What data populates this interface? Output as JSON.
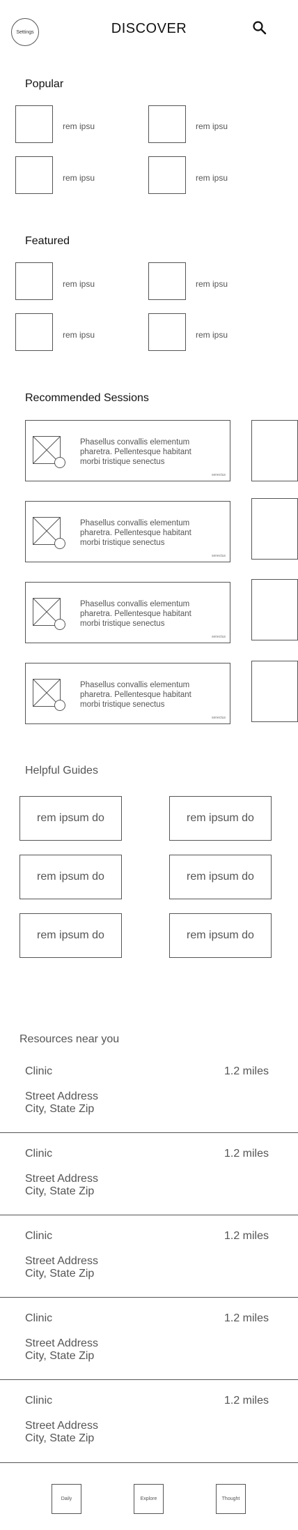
{
  "header": {
    "settings_label": "Settings",
    "title": "DISCOVER",
    "search_icon": "search-icon"
  },
  "popular": {
    "title": "Popular",
    "items": [
      {
        "label": "rem ipsu"
      },
      {
        "label": "rem ipsu"
      },
      {
        "label": "rem ipsu"
      },
      {
        "label": "rem ipsu"
      }
    ]
  },
  "featured": {
    "title": "Featured",
    "items": [
      {
        "label": "rem ipsu"
      },
      {
        "label": "rem ipsu"
      },
      {
        "label": "rem ipsu"
      },
      {
        "label": "rem ipsu"
      }
    ]
  },
  "recommended": {
    "title": "Recommended Sessions",
    "sessions": [
      {
        "description": "Phasellus convallis elementum pharetra. Pellentesque habitant morbi tristique senectus",
        "tag": "senectus"
      },
      {
        "description": "Phasellus convallis elementum pharetra. Pellentesque habitant morbi tristique senectus",
        "tag": "senectus"
      },
      {
        "description": "Phasellus convallis elementum pharetra. Pellentesque habitant morbi tristique senectus",
        "tag": "senectus"
      },
      {
        "description": "Phasellus convallis elementum pharetra. Pellentesque habitant morbi tristique senectus",
        "tag": "senectus"
      }
    ]
  },
  "guides": {
    "title": "Helpful Guides",
    "items": [
      {
        "label": "rem ipsum do"
      },
      {
        "label": "rem ipsum do"
      },
      {
        "label": "rem ipsum do"
      },
      {
        "label": "rem ipsum do"
      },
      {
        "label": "rem ipsum do"
      },
      {
        "label": "rem ipsum do"
      }
    ]
  },
  "resources": {
    "title": "Resources near you",
    "items": [
      {
        "name": "Clinic",
        "distance": "1.2 miles",
        "address_line1": "Street Address",
        "address_line2": "City, State Zip"
      },
      {
        "name": "Clinic",
        "distance": "1.2 miles",
        "address_line1": "Street Address",
        "address_line2": "City, State Zip"
      },
      {
        "name": "Clinic",
        "distance": "1.2 miles",
        "address_line1": "Street Address",
        "address_line2": "City, State Zip"
      },
      {
        "name": "Clinic",
        "distance": "1.2 miles",
        "address_line1": "Street Address",
        "address_line2": "City, State Zip"
      },
      {
        "name": "Clinic",
        "distance": "1.2 miles",
        "address_line1": "Street Address",
        "address_line2": "City, State Zip"
      }
    ]
  },
  "bottom_nav": {
    "items": [
      {
        "label": "Daily"
      },
      {
        "label": "Explore"
      },
      {
        "label": "Thought"
      }
    ]
  }
}
